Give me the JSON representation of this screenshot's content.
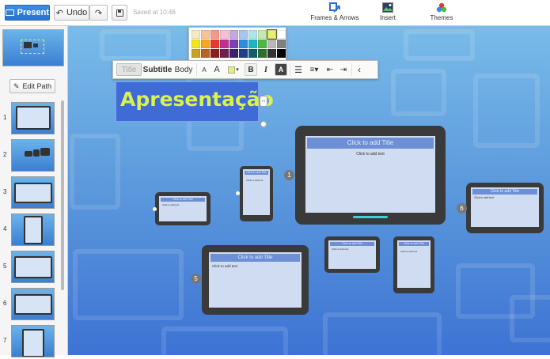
{
  "toolbar": {
    "present_label": "Present",
    "undo_label": "Undo",
    "saved_text": "Saved at 10:46",
    "frames_label": "Frames & Arrows",
    "insert_label": "Insert",
    "themes_label": "Themes"
  },
  "sidebar": {
    "edit_path_label": "Edit Path",
    "path_items": [
      {
        "num": "1"
      },
      {
        "num": "2"
      },
      {
        "num": "3"
      },
      {
        "num": "4"
      },
      {
        "num": "5"
      },
      {
        "num": "6"
      },
      {
        "num": "7"
      }
    ]
  },
  "format_bar": {
    "title_label": "Title",
    "subtitle_label": "Subtitle",
    "body_label": "Body",
    "size_small": "A",
    "size_large": "A",
    "bold": "B",
    "italic": "I",
    "highlight": "A",
    "back": "‹"
  },
  "palette": {
    "colors": [
      "#f7e9c4",
      "#f7c49a",
      "#f39a8a",
      "#f5c0d3",
      "#c3a8dc",
      "#a9c6ee",
      "#aee5ea",
      "#c9e6ac",
      "#e8f06a",
      "#ffffff",
      "#f5e51c",
      "#f5a623",
      "#e8392b",
      "#c22f8e",
      "#7d3fb8",
      "#2d8de0",
      "#1fb6c4",
      "#4cb848",
      "#b9b9b9",
      "#808080",
      "#c9a222",
      "#b8622a",
      "#8b1f1f",
      "#6e1f52",
      "#3c1f6e",
      "#1f3f8e",
      "#135e6b",
      "#2e6e2e",
      "#333333",
      "#000000"
    ],
    "selected_index": 8
  },
  "canvas": {
    "title_text": "Apresentação",
    "badges": [
      "1",
      "5",
      "6"
    ],
    "click_title": "Click to add Title",
    "click_text": "Click to add text"
  },
  "colors": {
    "accent": "#2a74cc",
    "title_color": "#d9f24d",
    "title_bg": "#3f6bd6"
  }
}
